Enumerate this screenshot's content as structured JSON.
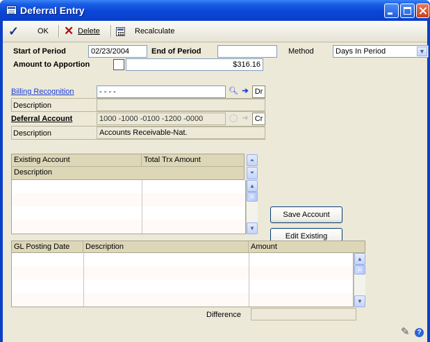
{
  "window": {
    "title": "Deferral Entry"
  },
  "toolbar": {
    "ok_label": "OK",
    "delete_label": "Delete",
    "recalc_label": "Recalculate"
  },
  "header": {
    "start_label": "Start of Period",
    "start_value": "02/23/2004",
    "end_label": "End of Period",
    "end_value": "",
    "method_label": "Method",
    "method_value": "Days In Period",
    "amount_label": "Amount to Apportion",
    "amount_value": "$316.16"
  },
  "billing": {
    "link_label": "Billing Recognition",
    "account_value": "-          -          -          -",
    "dr_label": "Dr",
    "desc_label": "Description",
    "desc_value": ""
  },
  "deferral": {
    "label": "Deferral Account",
    "account_value": "1000 -1000 -0100 -1200 -0000",
    "cr_label": "Cr",
    "desc_label": "Description",
    "desc_value": "Accounts Receivable-Nat."
  },
  "existing_grid": {
    "col1": "Existing Account",
    "col2": "Total Trx Amount",
    "col3": "Description",
    "rows": [
      [
        "",
        ""
      ],
      [
        "",
        ""
      ],
      [
        "",
        ""
      ],
      [
        "",
        ""
      ]
    ]
  },
  "buttons": {
    "save_account": "Save Account",
    "edit_existing": "Edit Existing"
  },
  "posting_grid": {
    "col1": "GL Posting Date",
    "col2": "Description",
    "col3": "Amount",
    "rows": [
      [
        "",
        "",
        ""
      ],
      [
        "",
        "",
        ""
      ],
      [
        "",
        "",
        ""
      ],
      [
        "",
        "",
        ""
      ]
    ]
  },
  "footer": {
    "difference_label": "Difference",
    "difference_value": ""
  },
  "icons": {
    "ok": "checkmark-icon",
    "delete": "x-icon",
    "recalc": "calculator-icon",
    "note": "note-icon",
    "lookup": "magnifier-icon",
    "expand": "arrow-right-icon",
    "help": "help-icon"
  }
}
